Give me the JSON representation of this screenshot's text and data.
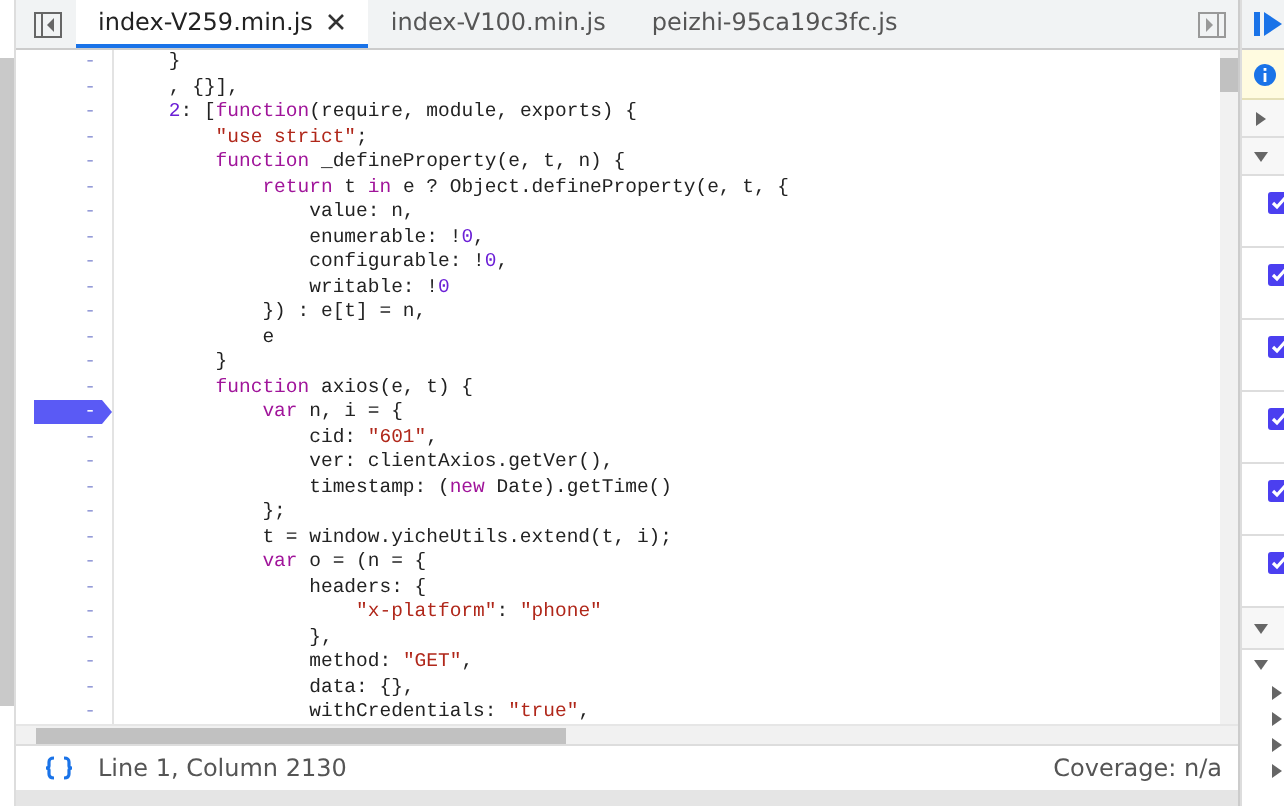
{
  "tabs": [
    {
      "label": "index-V259.min.js",
      "selected": true,
      "closable": true
    },
    {
      "label": "index-V100.min.js",
      "selected": false,
      "closable": false
    },
    {
      "label": "peizhi-95ca19c3fc.js",
      "selected": false,
      "closable": false
    }
  ],
  "code": [
    {
      "gutter": "-",
      "breakpoint": false,
      "segments": [
        {
          "text": "    }",
          "kind": "plain"
        }
      ]
    },
    {
      "gutter": "-",
      "breakpoint": false,
      "segments": [
        {
          "text": "    , {}],",
          "kind": "plain"
        }
      ]
    },
    {
      "gutter": "-",
      "breakpoint": false,
      "segments": [
        {
          "text": "    2",
          "kind": "number"
        },
        {
          "text": ": [",
          "kind": "plain"
        },
        {
          "text": "function",
          "kind": "keyword"
        },
        {
          "text": "(require, module, exports) {",
          "kind": "plain"
        }
      ]
    },
    {
      "gutter": "-",
      "breakpoint": false,
      "segments": [
        {
          "text": "        \"use strict\"",
          "kind": "string"
        },
        {
          "text": ";",
          "kind": "plain"
        }
      ]
    },
    {
      "gutter": "-",
      "breakpoint": false,
      "segments": [
        {
          "text": "        function",
          "kind": "keyword"
        },
        {
          "text": " _defineProperty(e, t, n) {",
          "kind": "plain"
        }
      ]
    },
    {
      "gutter": "-",
      "breakpoint": false,
      "segments": [
        {
          "text": "            return",
          "kind": "keyword"
        },
        {
          "text": " t ",
          "kind": "plain"
        },
        {
          "text": "in",
          "kind": "keyword"
        },
        {
          "text": " e ? Object.defineProperty(e, t, {",
          "kind": "plain"
        }
      ]
    },
    {
      "gutter": "-",
      "breakpoint": false,
      "segments": [
        {
          "text": "                value: n,",
          "kind": "plain"
        }
      ]
    },
    {
      "gutter": "-",
      "breakpoint": false,
      "segments": [
        {
          "text": "                enumerable: !",
          "kind": "plain"
        },
        {
          "text": "0",
          "kind": "number"
        },
        {
          "text": ",",
          "kind": "plain"
        }
      ]
    },
    {
      "gutter": "-",
      "breakpoint": false,
      "segments": [
        {
          "text": "                configurable: !",
          "kind": "plain"
        },
        {
          "text": "0",
          "kind": "number"
        },
        {
          "text": ",",
          "kind": "plain"
        }
      ]
    },
    {
      "gutter": "-",
      "breakpoint": false,
      "segments": [
        {
          "text": "                writable: !",
          "kind": "plain"
        },
        {
          "text": "0",
          "kind": "number"
        }
      ]
    },
    {
      "gutter": "-",
      "breakpoint": false,
      "segments": [
        {
          "text": "            }) : e[t] = n,",
          "kind": "plain"
        }
      ]
    },
    {
      "gutter": "-",
      "breakpoint": false,
      "segments": [
        {
          "text": "            e",
          "kind": "plain"
        }
      ]
    },
    {
      "gutter": "-",
      "breakpoint": false,
      "segments": [
        {
          "text": "        }",
          "kind": "plain"
        }
      ]
    },
    {
      "gutter": "-",
      "breakpoint": false,
      "segments": [
        {
          "text": "        function",
          "kind": "keyword"
        },
        {
          "text": " axios(e, t) {",
          "kind": "plain"
        }
      ]
    },
    {
      "gutter": "-",
      "breakpoint": true,
      "segments": [
        {
          "text": "            var",
          "kind": "keyword"
        },
        {
          "text": " n, i = {",
          "kind": "plain"
        }
      ]
    },
    {
      "gutter": "-",
      "breakpoint": false,
      "segments": [
        {
          "text": "                cid: ",
          "kind": "plain"
        },
        {
          "text": "\"601\"",
          "kind": "string"
        },
        {
          "text": ",",
          "kind": "plain"
        }
      ]
    },
    {
      "gutter": "-",
      "breakpoint": false,
      "segments": [
        {
          "text": "                ver: clientAxios.getVer(),",
          "kind": "plain"
        }
      ]
    },
    {
      "gutter": "-",
      "breakpoint": false,
      "segments": [
        {
          "text": "                timestamp: (",
          "kind": "plain"
        },
        {
          "text": "new",
          "kind": "keyword"
        },
        {
          "text": " Date).getTime()",
          "kind": "plain"
        }
      ]
    },
    {
      "gutter": "-",
      "breakpoint": false,
      "segments": [
        {
          "text": "            };",
          "kind": "plain"
        }
      ]
    },
    {
      "gutter": "-",
      "breakpoint": false,
      "segments": [
        {
          "text": "            t = window.yicheUtils.extend(t, i);",
          "kind": "plain"
        }
      ]
    },
    {
      "gutter": "-",
      "breakpoint": false,
      "segments": [
        {
          "text": "            var",
          "kind": "keyword"
        },
        {
          "text": " o = (n = {",
          "kind": "plain"
        }
      ]
    },
    {
      "gutter": "-",
      "breakpoint": false,
      "segments": [
        {
          "text": "                headers: {",
          "kind": "plain"
        }
      ]
    },
    {
      "gutter": "-",
      "breakpoint": false,
      "segments": [
        {
          "text": "                    \"x-platform\"",
          "kind": "string"
        },
        {
          "text": ": ",
          "kind": "plain"
        },
        {
          "text": "\"phone\"",
          "kind": "string"
        }
      ]
    },
    {
      "gutter": "-",
      "breakpoint": false,
      "segments": [
        {
          "text": "                },",
          "kind": "plain"
        }
      ]
    },
    {
      "gutter": "-",
      "breakpoint": false,
      "segments": [
        {
          "text": "                method: ",
          "kind": "plain"
        },
        {
          "text": "\"GET\"",
          "kind": "string"
        },
        {
          "text": ",",
          "kind": "plain"
        }
      ]
    },
    {
      "gutter": "-",
      "breakpoint": false,
      "segments": [
        {
          "text": "                data: {},",
          "kind": "plain"
        }
      ]
    },
    {
      "gutter": "-",
      "breakpoint": false,
      "segments": [
        {
          "text": "                withCredentials: ",
          "kind": "plain"
        },
        {
          "text": "\"true\"",
          "kind": "string"
        },
        {
          "text": ",",
          "kind": "plain"
        }
      ]
    }
  ],
  "status_bar": {
    "position": "Line 1, Column 2130",
    "coverage": "Coverage: n/a"
  },
  "side_panel": {
    "sections": [
      {
        "expanded": false
      },
      {
        "expanded": true
      }
    ],
    "breakpoints": [
      {
        "checked": true
      },
      {
        "checked": true
      },
      {
        "checked": true
      },
      {
        "checked": true
      },
      {
        "checked": true
      },
      {
        "checked": true
      }
    ],
    "scope": {
      "expanded": true,
      "children": [
        {
          "expanded": true
        }
      ]
    }
  }
}
